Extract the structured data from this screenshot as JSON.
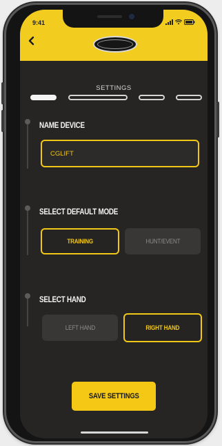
{
  "status_bar": {
    "time": "9:41"
  },
  "wizard": {
    "title": "SETTINGS",
    "steps": [
      {
        "label": "step-1",
        "state": "completed"
      },
      {
        "label": "step-2",
        "state": "current"
      },
      {
        "label": "step-3",
        "state": "upcoming"
      },
      {
        "label": "step-4",
        "state": "upcoming"
      }
    ]
  },
  "name_device": {
    "title": "NAME DEVICE",
    "value": "CGLIFT"
  },
  "default_mode": {
    "title": "SELECT DEFAULT MODE",
    "options": [
      "TRAINING",
      "HUNT/EVENT"
    ],
    "selected": "TRAINING"
  },
  "hand": {
    "title": "SELECT HAND",
    "options": [
      "LEFT HAND",
      "RIGHT HAND"
    ],
    "selected": "RIGHT HAND"
  },
  "save_label": "SAVE SETTINGS",
  "colors": {
    "accent": "#f3cc20",
    "background": "#272524",
    "unselected": "#383736"
  },
  "icons": [
    "back-arrow-icon",
    "signal-icon",
    "wifi-icon",
    "battery-icon",
    "brand-logo"
  ]
}
